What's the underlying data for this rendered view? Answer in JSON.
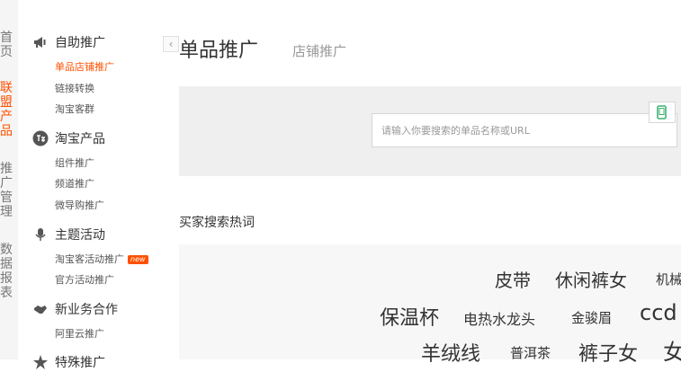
{
  "left_nav": {
    "items": [
      {
        "label": "首页"
      },
      {
        "label": "联盟产品",
        "active": true
      },
      {
        "label": "推广管理"
      },
      {
        "label": "数据报表"
      }
    ]
  },
  "sidebar": {
    "collapse_icon": "chevron-left-icon",
    "groups": [
      {
        "title": "自助推广",
        "icon": "megaphone-icon",
        "items": [
          {
            "label": "单品店铺推广",
            "active": true
          },
          {
            "label": "链接转换"
          },
          {
            "label": "淘宝客群"
          }
        ]
      },
      {
        "title": "淘宝产品",
        "icon": "taobao-logo-icon",
        "items": [
          {
            "label": "组件推广"
          },
          {
            "label": "频道推广"
          },
          {
            "label": "微导购推广"
          }
        ]
      },
      {
        "title": "主题活动",
        "icon": "microphone-icon",
        "items": [
          {
            "label": "淘宝客活动推广",
            "badge": "new"
          },
          {
            "label": "官方活动推广"
          }
        ]
      },
      {
        "title": "新业务合作",
        "icon": "handshake-icon",
        "items": [
          {
            "label": "阿里云推广"
          }
        ]
      },
      {
        "title": "特殊推广",
        "icon": "star-icon",
        "items": []
      }
    ]
  },
  "main": {
    "tabs": [
      {
        "label": "单品推广",
        "active": true
      },
      {
        "label": "店铺推广"
      }
    ],
    "search": {
      "placeholder": "请输入你要搜索的单品名称或URL",
      "value": "",
      "scan_icon": "phone-scan-icon"
    },
    "hot_keywords": {
      "title": "买家搜索热词",
      "keywords": [
        "皮带",
        "休闲裤女",
        "机械",
        "保温杯",
        "电热水龙头",
        "金骏眉",
        "ccd",
        "羊绒线",
        "普洱茶",
        "裤子女",
        "女"
      ]
    }
  },
  "colors": {
    "accent": "#ff5000",
    "panel": "#efefef",
    "hot_panel": "#f7f7f7"
  }
}
